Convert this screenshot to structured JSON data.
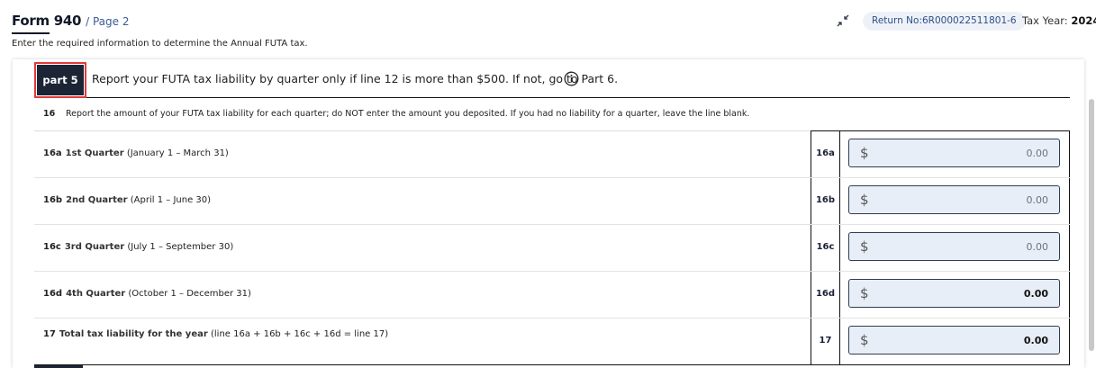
{
  "header": {
    "form_title": "Form 940",
    "page_label": "/ Page 2",
    "subtitle": "Enter the required information to determine the Annual FUTA tax.",
    "return_no": "Return No:6R000022511801-6",
    "tax_year_label": "Tax Year:",
    "tax_year_value": "2024",
    "icons": {
      "collapse": "collapse-arrows-icon"
    }
  },
  "part": {
    "badge": "part 5",
    "instruction": "Report your FUTA tax liability by quarter only if line 12 is more than $500. If not, go to Part 6.",
    "info_icon": "info-icon"
  },
  "line16": {
    "number": "16",
    "text": "Report the amount of your FUTA tax liability for each quarter; do NOT enter the amount you deposited. If you had no liability for a quarter, leave the line blank."
  },
  "rows": [
    {
      "code": "16a",
      "name": "1st Quarter",
      "range": "(January 1 – March 31)",
      "line_code": "16a",
      "currency": "$",
      "value": "0.00"
    },
    {
      "code": "16b",
      "name": "2nd Quarter",
      "range": "(April 1 – June 30)",
      "line_code": "16b",
      "currency": "$",
      "value": "0.00"
    },
    {
      "code": "16c",
      "name": "3rd Quarter",
      "range": "(July 1 – September 30)",
      "line_code": "16c",
      "currency": "$",
      "value": "0.00"
    },
    {
      "code": "16d",
      "name": "4th Quarter",
      "range": "(October 1 – December 31)",
      "line_code": "16d",
      "currency": "$",
      "value": "0.00"
    },
    {
      "code": "17",
      "name": "Total tax liability for the year",
      "range": "(line 16a + 16b + 16c + 16d = line 17)",
      "line_code": "17",
      "currency": "$",
      "value": "0.00"
    }
  ],
  "colors": {
    "accent": "#1b2535",
    "highlight": "#e03a3a",
    "input_bg": "#e8eef7",
    "badge_bg": "#eef2f8"
  }
}
